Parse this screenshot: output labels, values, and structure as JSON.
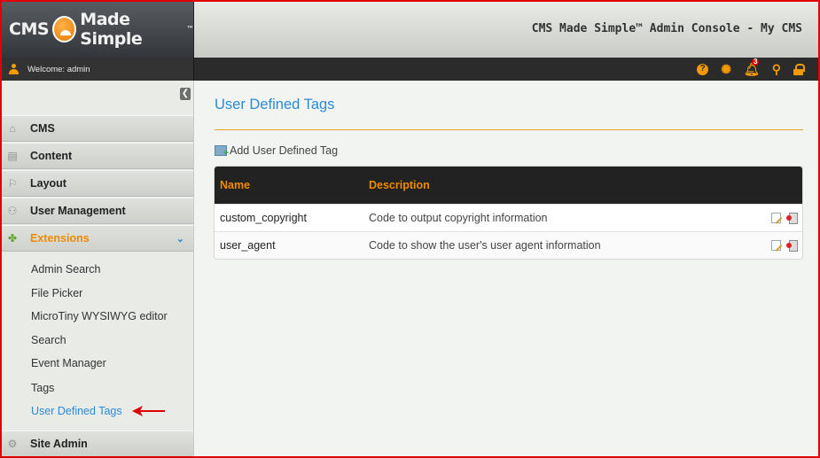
{
  "header": {
    "logo_text": "CMS Made Simple",
    "console_title": "CMS Made Simple™ Admin Console - My CMS"
  },
  "userbar": {
    "welcome": "Welcome: admin",
    "notification_count": "3"
  },
  "sidebar": {
    "sections": [
      {
        "label": "CMS",
        "icon": "home-icon"
      },
      {
        "label": "Content",
        "icon": "page-icon"
      },
      {
        "label": "Layout",
        "icon": "layout-icon"
      },
      {
        "label": "User Management",
        "icon": "users-icon"
      },
      {
        "label": "Extensions",
        "icon": "puzzle-icon"
      },
      {
        "label": "Site Admin",
        "icon": "gear-icon"
      }
    ],
    "extension_items": [
      "Admin Search",
      "File Picker",
      "MicroTiny WYSIWYG editor",
      "Search",
      "Event Manager",
      "Tags",
      "User Defined Tags"
    ]
  },
  "main": {
    "title": "User Defined Tags",
    "add_label": "Add User Defined Tag",
    "columns": [
      "Name",
      "Description"
    ],
    "rows": [
      {
        "name": "custom_copyright",
        "description": "Code to output copyright information"
      },
      {
        "name": "user_agent",
        "description": "Code to show the user's user agent information"
      }
    ]
  },
  "colors": {
    "accent_orange": "#f08a00",
    "link_blue": "#2b8ad6",
    "annotation_red": "#e00000"
  }
}
